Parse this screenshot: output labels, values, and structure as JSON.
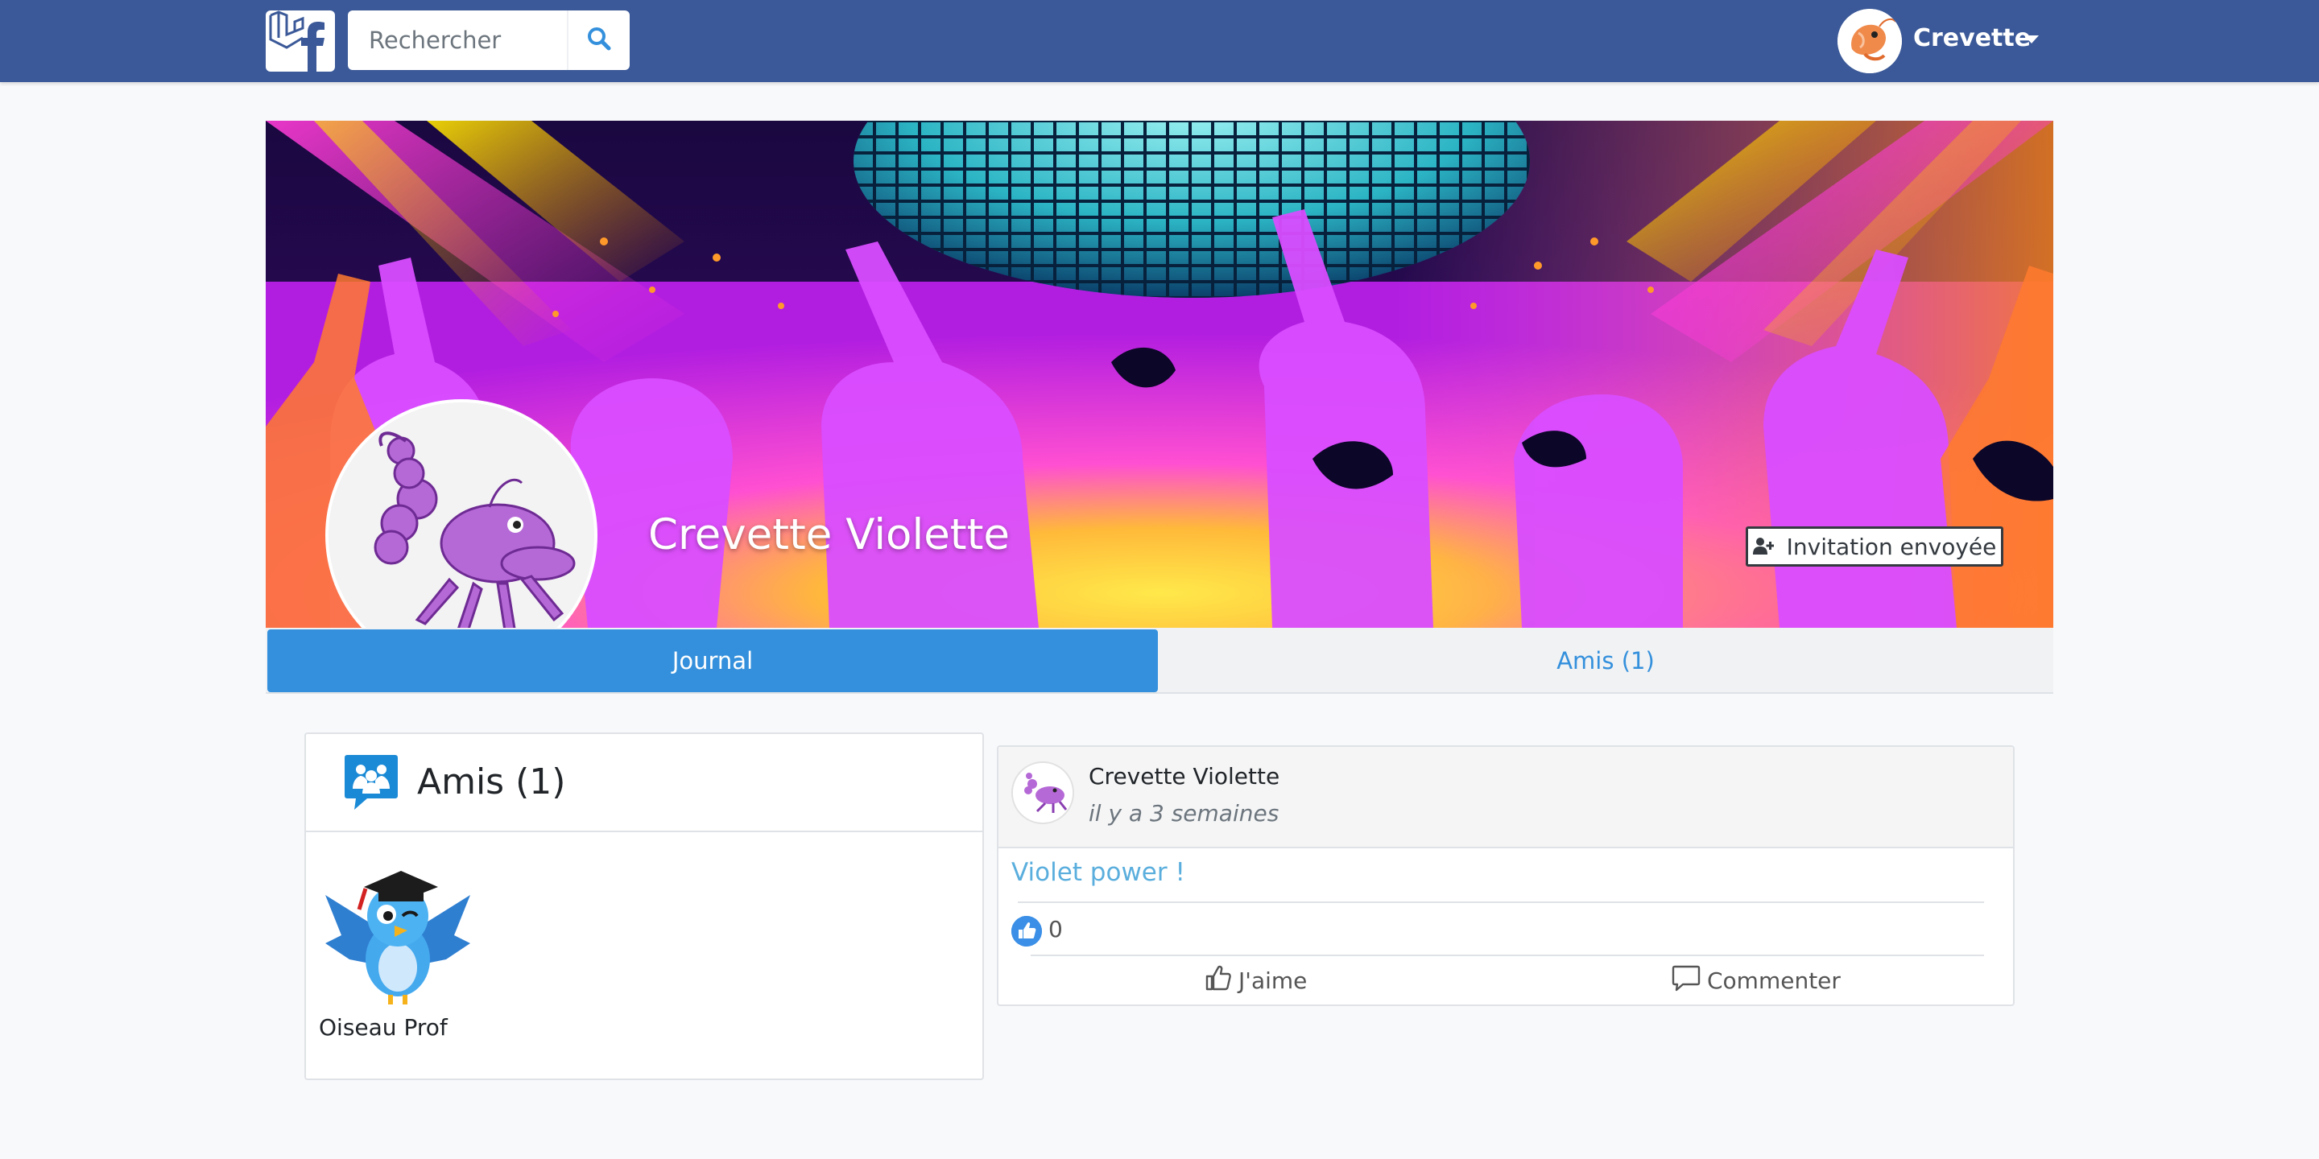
{
  "navbar": {
    "search": {
      "placeholder": "Rechercher"
    },
    "user": {
      "name": "Crevette"
    }
  },
  "profile": {
    "name": "Crevette Violette",
    "invite_button_label": "Invitation envoyée"
  },
  "tabs": [
    {
      "label": "Journal",
      "active": true
    },
    {
      "label": "Amis (1)",
      "active": false
    }
  ],
  "friends_panel": {
    "title": "Amis (1)",
    "friends": [
      {
        "name": "Oiseau Prof"
      }
    ]
  },
  "post": {
    "author": "Crevette Violette",
    "time": "il y a 3 semaines",
    "content": "Violet power !",
    "like_count": "0",
    "actions": {
      "like_label": "J'aime",
      "comment_label": "Commenter"
    }
  },
  "colors": {
    "navbar": "#3b5998",
    "accent": "#3490dc",
    "post_link": "#5aaedd"
  }
}
